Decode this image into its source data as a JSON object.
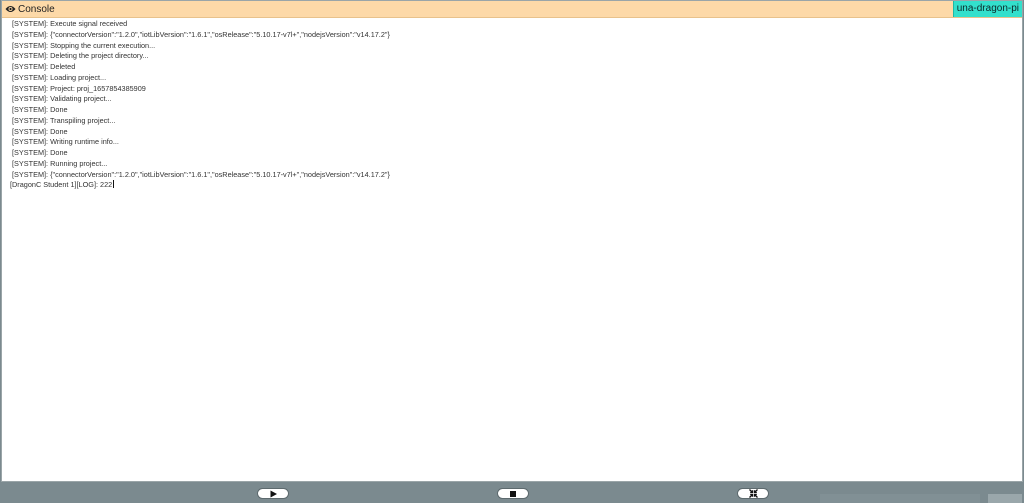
{
  "console": {
    "title": "Console",
    "icon": "eye-icon",
    "device": "una-dragon-pi",
    "colors": {
      "header_bg": "#fdd9a8",
      "device_badge_bg": "#33e0cc",
      "toolbar_bg": "#7b8a8f"
    },
    "lines": [
      "[SYSTEM]: Execute signal received",
      "[SYSTEM]: {\"connectorVersion\":\"1.2.0\",\"iotLibVersion\":\"1.6.1\",\"osRelease\":\"5.10.17-v7l+\",\"nodejsVersion\":\"v14.17.2\"}",
      "[SYSTEM]: Stopping the current execution...",
      "[SYSTEM]: Deleting the project directory...",
      "[SYSTEM]: Deleted",
      "[SYSTEM]: Loading project...",
      "[SYSTEM]: Project: proj_1657854385909",
      "[SYSTEM]: Validating project...",
      "[SYSTEM]: Done",
      "[SYSTEM]: Transpiling project...",
      "[SYSTEM]: Done",
      "[SYSTEM]: Writing runtime info...",
      "[SYSTEM]: Done",
      "[SYSTEM]: Running project...",
      "[SYSTEM]: {\"connectorVersion\":\"1.2.0\",\"iotLibVersion\":\"1.6.1\",\"osRelease\":\"5.10.17-v7l+\",\"nodejsVersion\":\"v14.17.2\"}"
    ],
    "user_line": "[DragonC Student 1][LOG]: 222"
  },
  "toolbar": {
    "play_icon": "play-icon",
    "stop_icon": "stop-icon",
    "collapse_icon": "collapse-arrows-icon"
  }
}
